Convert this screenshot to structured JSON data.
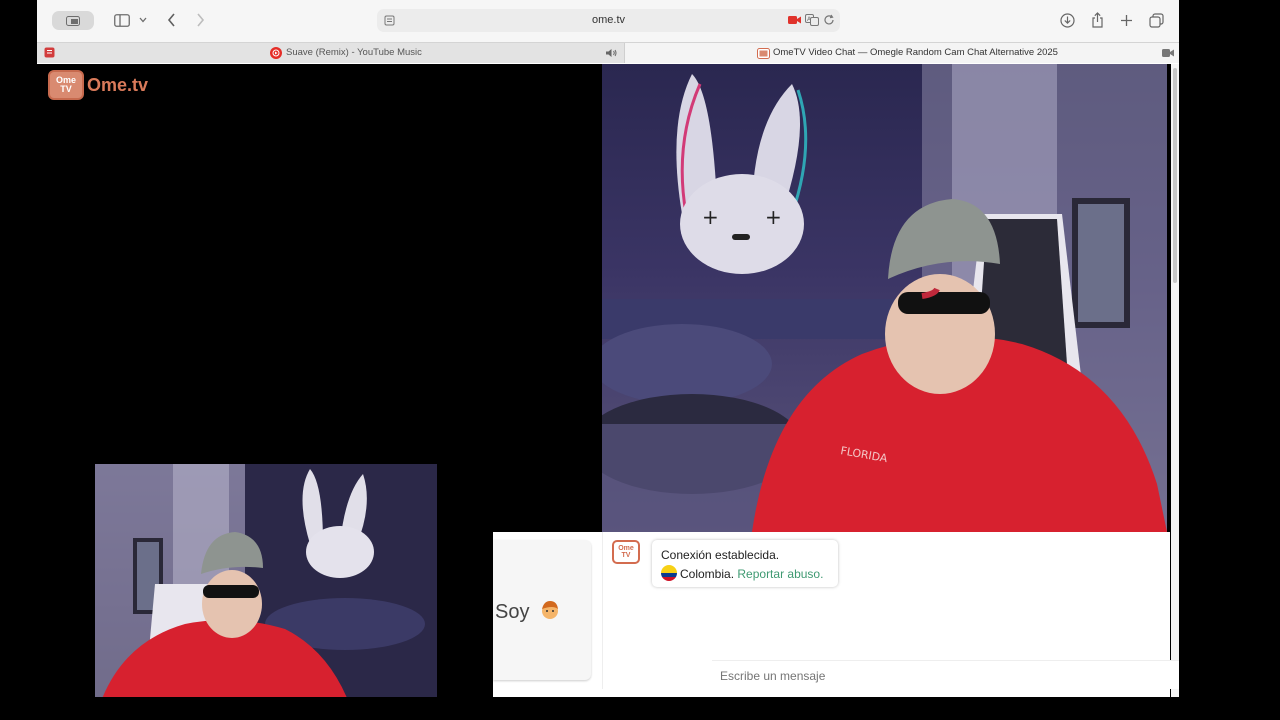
{
  "browser": {
    "address": "ome.tv",
    "tabs": [
      {
        "label": "Suave (Remix) - YouTube Music",
        "active": false
      },
      {
        "label": "OmeTV Video Chat — Omegle Random Cam Chat Alternative 2025",
        "active": true
      }
    ]
  },
  "site": {
    "logo_badge_line1": "Ome",
    "logo_badge_line2": "TV",
    "logo_text": "Ome.tv"
  },
  "chat": {
    "left_card_text": "Soy",
    "message_logo_line1": "Ome",
    "message_logo_line2": "TV",
    "connection_text": "Conexión establecida.",
    "country": "Colombia.",
    "report_link": "Reportar abuso.",
    "input_placeholder": "Escribe un mensaje"
  },
  "colors": {
    "brand": "#d97a5a",
    "link": "#3f9a72",
    "recording": "#e0322b"
  }
}
